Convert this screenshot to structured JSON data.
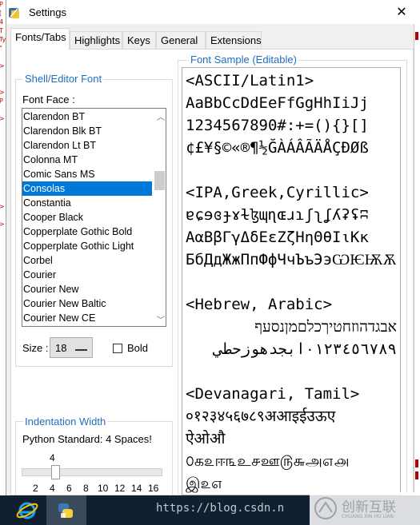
{
  "window": {
    "title": "Settings",
    "close_glyph": "✕"
  },
  "left_strip_marks": [
    "P",
    "[",
    "4",
    "T",
    "Ty",
    "\"",
    "",
    ">",
    "",
    "",
    ">",
    "P",
    "",
    ">",
    "",
    "",
    "",
    "",
    "",
    "",
    "",
    "",
    "",
    ">",
    "",
    ">"
  ],
  "tabs": [
    {
      "label": "Fonts/Tabs",
      "active": true
    },
    {
      "label": "Highlights",
      "active": false
    },
    {
      "label": "Keys",
      "active": false
    },
    {
      "label": "General",
      "active": false
    },
    {
      "label": "Extensions",
      "active": false
    }
  ],
  "shell_font": {
    "legend": "Shell/Editor Font",
    "font_face_label": "Font Face :",
    "fonts": [
      "Clarendon BT",
      "Clarendon Blk BT",
      "Clarendon Lt BT",
      "Colonna MT",
      "Comic Sans MS",
      "Consolas",
      "Constantia",
      "Cooper Black",
      "Copperplate Gothic Bold",
      "Copperplate Gothic Light",
      "Corbel",
      "Courier",
      "Courier New",
      "Courier New Baltic",
      "Courier New CE"
    ],
    "selected_font": "Consolas",
    "size_label": "Size :",
    "size_value": "18",
    "bold_label": "Bold",
    "bold_checked": false
  },
  "font_sample": {
    "legend": "Font Sample (Editable)",
    "lines": [
      "<ASCII/Latin1>",
      "AaBbCcDdEeFfGgHhIiJj",
      "1234567890#:+=(){}[]",
      "¢£¥§©«®¶½ĞÀÁÂÃÄÅÇÐØß",
      "",
      "<IPA,Greek,Cyrillic>",
      "ɐɕɘɞɟɤɫɮɰɳɶɹɿʃʅʆʎʡʢʭ",
      "ΑαΒβΓγΔδΕεΖζΗηΘθΙιΚκ",
      "БбДдЖжПпФфЧчЪъЭэѠѤѬѪ",
      "",
      "<Hebrew, Arabic>",
      "אבגדהוזחטיךכלםמןנסעף",
      "٠١٢٣٤٥٦٧٨٩ابجدهوزحطي",
      "",
      "<Devanagari, Tamil>",
      "०१२३४५६७८९अआइईउऊए",
      "ऐओऔ",
      "௦க௨ஈ௩உ௪ஊ௫௬அ௭௮",
      "இ௨௭"
    ]
  },
  "indentation": {
    "legend": "Indentation Width",
    "description": "Python Standard: 4 Spaces!",
    "current_value": "4",
    "ticks": [
      "2",
      "4",
      "6",
      "8",
      "10",
      "12",
      "14",
      "16"
    ],
    "level_fraction": 0.14
  },
  "taskbar": {
    "watermark_url": "https://blog.csdn.n",
    "watermark_logo_text": "创新互联",
    "watermark_logo_sub": "CHUANG XIN HU LIAN"
  },
  "colors": {
    "accent": "#0078d7",
    "legend": "#1f6ebd",
    "taskbar": "#102030"
  }
}
